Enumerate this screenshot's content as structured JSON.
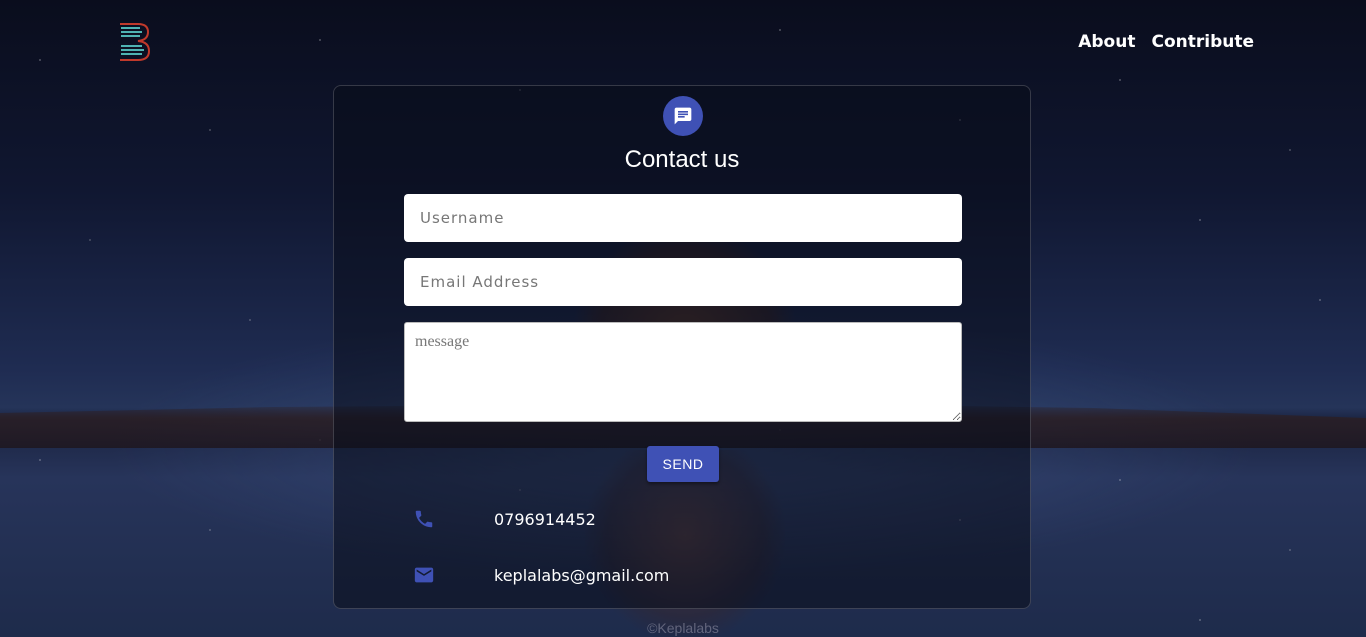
{
  "nav": {
    "about": "About",
    "contribute": "Contribute"
  },
  "card": {
    "title": "Contact us",
    "username_placeholder": "Username",
    "email_placeholder": "Email Address",
    "message_placeholder": "message",
    "send_label": "SEND"
  },
  "contact": {
    "phone": "0796914452",
    "email": "keplalabs@gmail.com"
  },
  "footer": {
    "text": "©Keplalabs"
  },
  "icons": {
    "logo": "logo-icon",
    "chat": "chat-icon",
    "phone": "phone-icon",
    "mail": "mail-icon"
  },
  "colors": {
    "accent": "#3f51b5",
    "logo_red": "#c0392b",
    "logo_teal": "#4fb3b3"
  }
}
